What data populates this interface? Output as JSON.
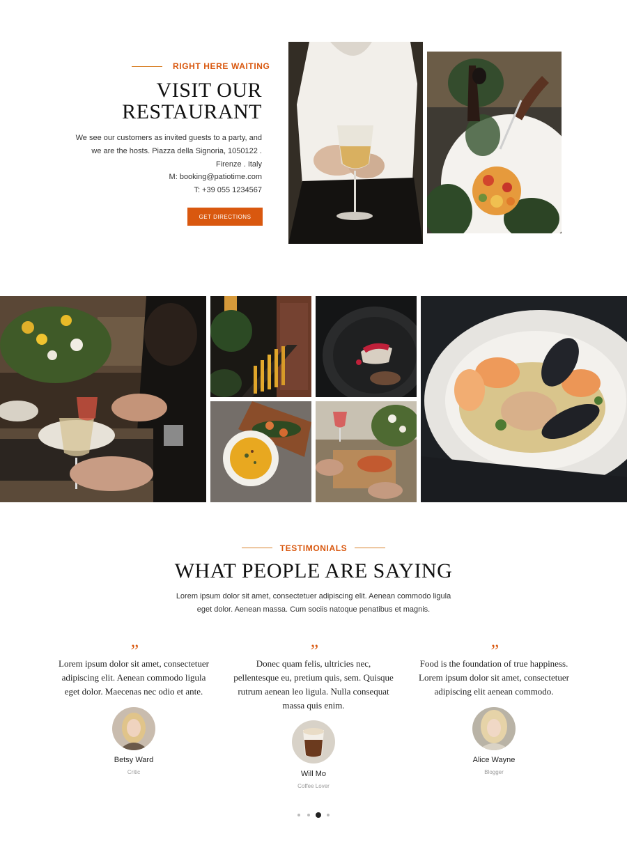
{
  "visit": {
    "eyebrow": "RIGHT HERE WAITING",
    "title_line1": "VISIT OUR",
    "title_line2": "RESTAURANT",
    "description": "We see our customers as invited guests to a party, and we are the hosts. Piazza della Signoria, 1050122 . Firenze . Italy",
    "email": "M: booking@patiotime.com",
    "phone": "T: +39 055 1234567",
    "button_label": "GET DIRECTIONS"
  },
  "testimonials": {
    "eyebrow": "TESTIMONIALS",
    "title": "WHAT PEOPLE ARE SAYING",
    "subtitle": "Lorem ipsum dolor sit amet, consectetuer adipiscing elit. Aenean commodo ligula eget dolor. Aenean massa. Cum sociis natoque penatibus et magnis.",
    "items": [
      {
        "quote_mark": "”",
        "text": "Lorem ipsum dolor sit amet, consectetuer adipiscing elit. Aenean commodo ligula eget dolor. Maecenas nec odio et ante.",
        "name": "Betsy Ward",
        "role": "Critic"
      },
      {
        "quote_mark": "”",
        "text": "Donec quam felis, ultricies nec, pellentesque eu, pretium quis, sem. Quisque rutrum aenean leo ligula. Nulla consequat massa quis enim.",
        "name": "Will Mo",
        "role": "Coffee Lover"
      },
      {
        "quote_mark": "”",
        "text": "Food is the foundation of true happiness. Lorem ipsum dolor sit amet, consectetuer adipiscing elit aenean commodo.",
        "name": "Alice Wayne",
        "role": "Blogger"
      }
    ],
    "pager": {
      "count": 4,
      "active_index": 2
    }
  },
  "colors": {
    "accent": "#d9580f",
    "text": "#222222"
  }
}
